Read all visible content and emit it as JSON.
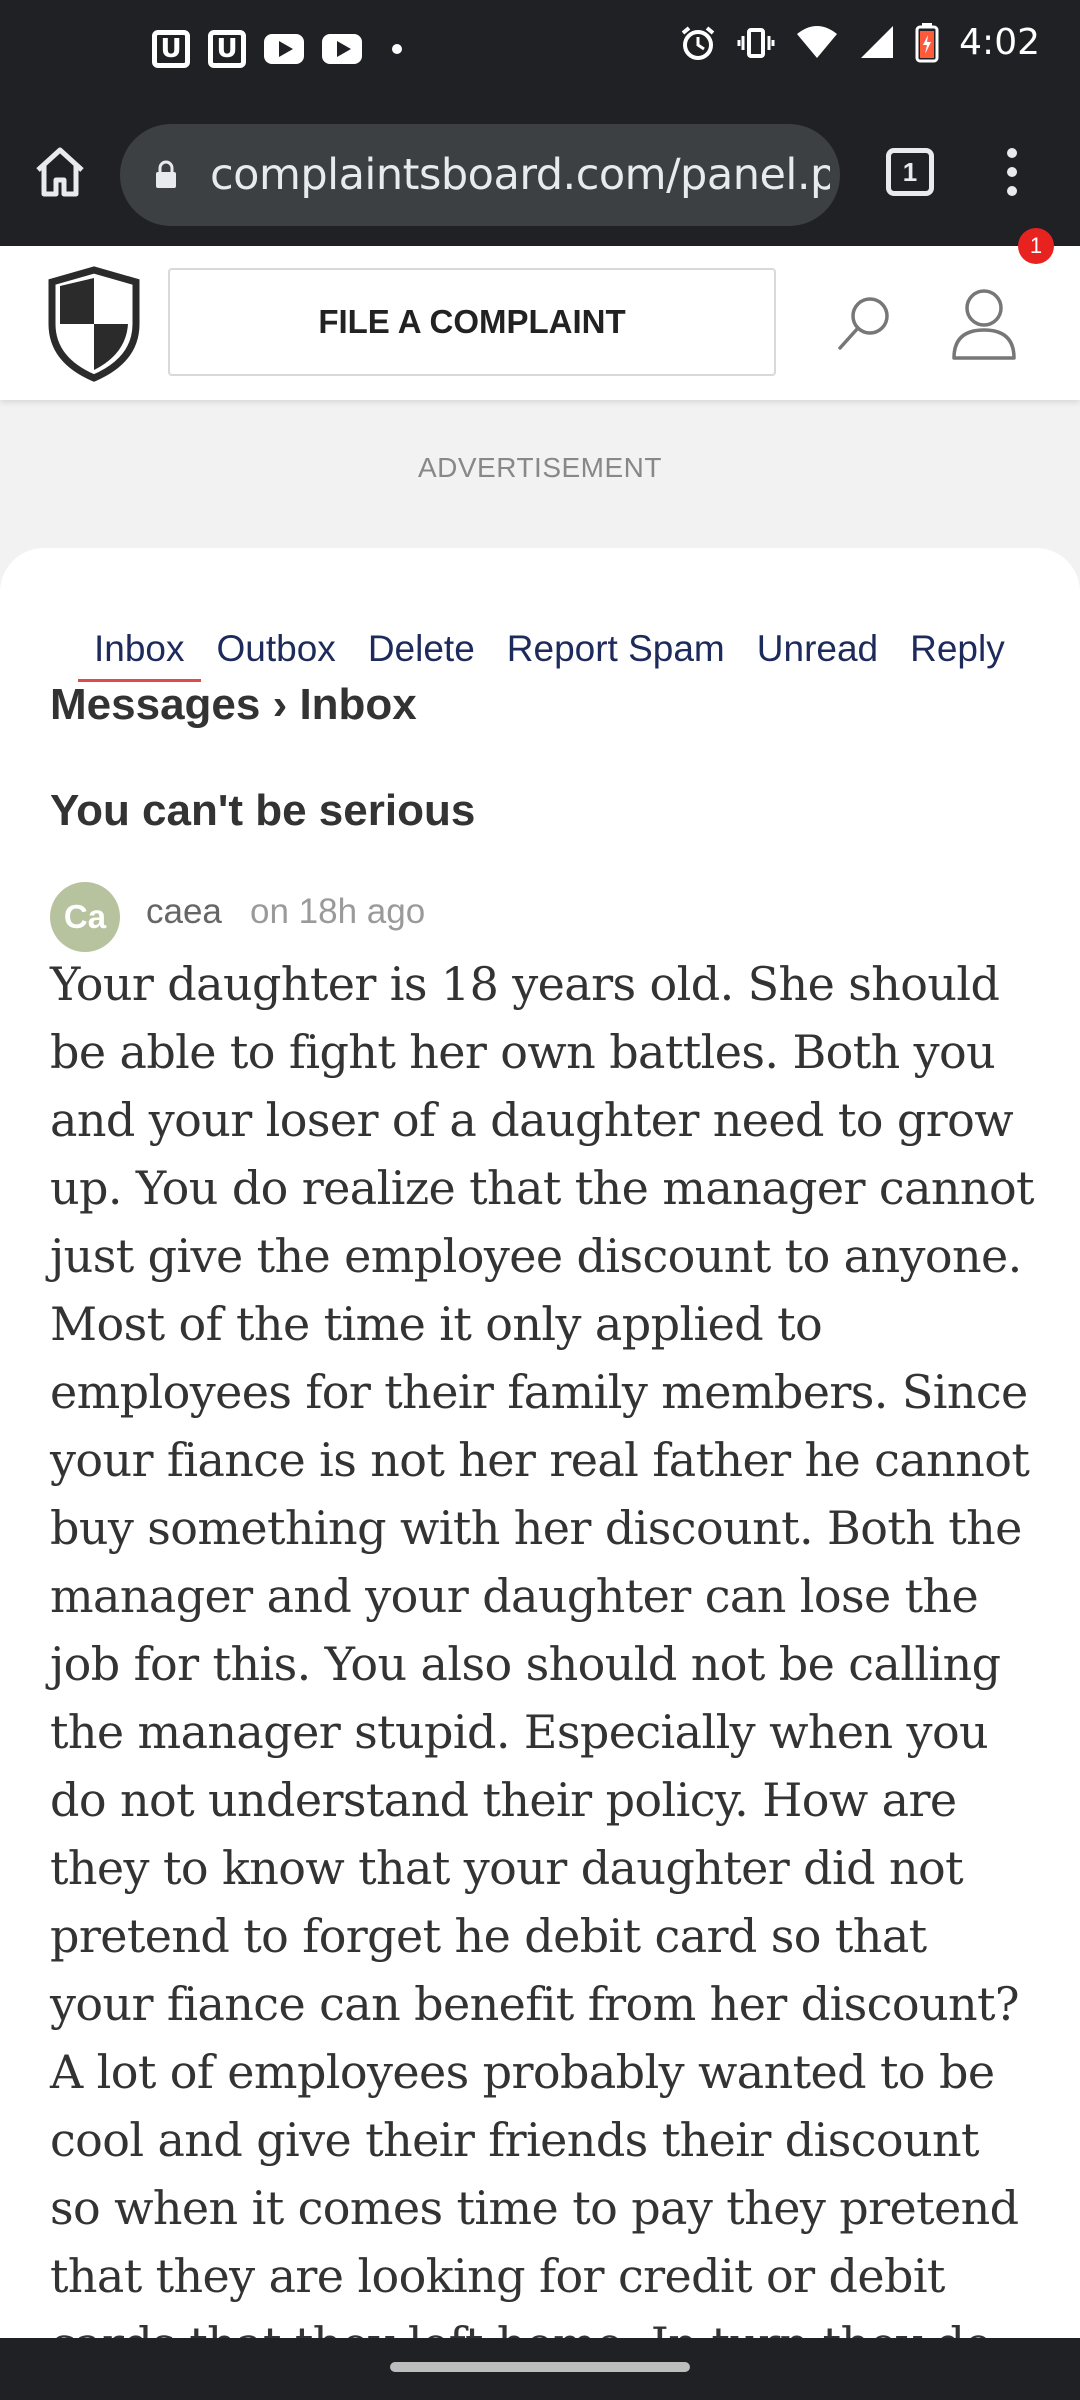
{
  "status_bar": {
    "left_icons": [
      "u-app-icon",
      "u-app-icon",
      "youtube-icon",
      "youtube-icon",
      "dot-icon"
    ],
    "u_glyph": "U",
    "right_icons": [
      "alarm-icon",
      "vibrate-icon",
      "wifi-icon",
      "signal-icon",
      "battery-icon"
    ],
    "time": "4:02"
  },
  "browser": {
    "url": "complaintsboard.com/panel.ph",
    "tab_count": "1"
  },
  "site_header": {
    "file_complaint_label": "FILE A COMPLAINT",
    "notification_count": "1"
  },
  "ad_label": "ADVERTISEMENT",
  "messages": {
    "tabs": [
      {
        "label": "Inbox",
        "active": true
      },
      {
        "label": "Outbox",
        "active": false
      },
      {
        "label": "Delete",
        "active": false
      },
      {
        "label": "Report Spam",
        "active": false
      },
      {
        "label": "Unread",
        "active": false
      },
      {
        "label": "Reply",
        "active": false
      }
    ],
    "breadcrumb": "Messages › Inbox",
    "subject": "You can't be serious",
    "author_initials": "Ca",
    "author": "caea",
    "time": "on 18h ago",
    "body": "Your daughter is 18 years old. She should be able to fight her own battles. Both you and your loser of a daughter need to grow up. You do realize that the manager cannot just give the employee discount to anyone. Most of the time it only applied to employees for their family members. Since your fiance is not her real father he cannot buy something with her discount. Both the manager and your daughter can lose the job for this. You also should not be calling the manager stupid. Especially when you do not understand their policy. How are they to know that your daughter did not pretend to forget he debit card so that your fiance can benefit from her discount? A lot of employees probably wanted to be cool and give their friends their discount so when it comes time to pay they pretend that they are looking for credit or debit cards that they left home. In turn they do not have cash so the friend pays and gets the discount. Either way"
  },
  "colors": {
    "status_bar": "#202124",
    "tab_text": "#1c2a5c",
    "tab_underline": "#e14a4a",
    "badge": "#e8231f",
    "avatar": "#b7c39e"
  }
}
